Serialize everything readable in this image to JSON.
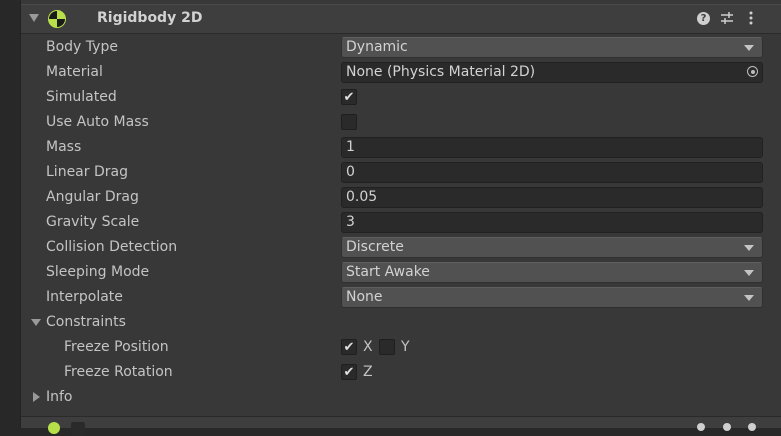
{
  "component": {
    "title": "Rigidbody 2D",
    "icon": "rigidbody-2d-icon",
    "accent_color": "#b8e04a"
  },
  "fields": {
    "body_type": {
      "label": "Body Type",
      "value": "Dynamic"
    },
    "material": {
      "label": "Material",
      "value": "None (Physics Material 2D)"
    },
    "simulated": {
      "label": "Simulated",
      "checked": true
    },
    "use_auto_mass": {
      "label": "Use Auto Mass",
      "checked": false
    },
    "mass": {
      "label": "Mass",
      "value": "1"
    },
    "linear_drag": {
      "label": "Linear Drag",
      "value": "0"
    },
    "angular_drag": {
      "label": "Angular Drag",
      "value": "0.05"
    },
    "gravity_scale": {
      "label": "Gravity Scale",
      "value": "3"
    },
    "collision_detection": {
      "label": "Collision Detection",
      "value": "Discrete"
    },
    "sleeping_mode": {
      "label": "Sleeping Mode",
      "value": "Start Awake"
    },
    "interpolate": {
      "label": "Interpolate",
      "value": "None"
    }
  },
  "constraints": {
    "label": "Constraints",
    "freeze_position": {
      "label": "Freeze Position",
      "x_label": "X",
      "x_checked": true,
      "y_label": "Y",
      "y_checked": false
    },
    "freeze_rotation": {
      "label": "Freeze Rotation",
      "z_label": "Z",
      "z_checked": true
    }
  },
  "info": {
    "label": "Info"
  },
  "icons": {
    "check": "✔"
  }
}
